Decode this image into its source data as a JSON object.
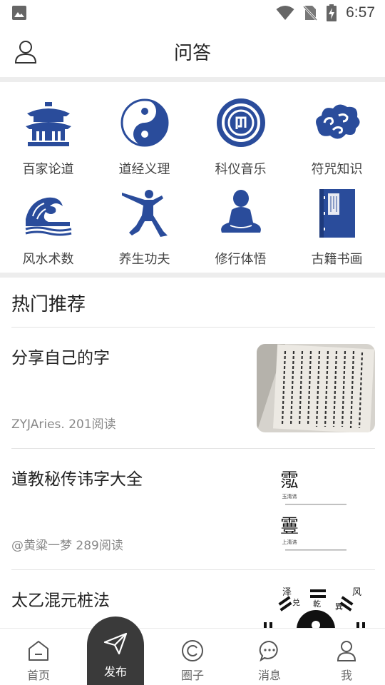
{
  "status_bar": {
    "time": "6:57"
  },
  "header": {
    "title": "问答"
  },
  "categories": [
    {
      "label": "百家论道",
      "icon": "temple-icon"
    },
    {
      "label": "道经义理",
      "icon": "yin-yang-icon"
    },
    {
      "label": "科仪音乐",
      "icon": "music-seal-icon"
    },
    {
      "label": "符咒知识",
      "icon": "cloud-icon"
    },
    {
      "label": "风水术数",
      "icon": "wave-icon"
    },
    {
      "label": "养生功夫",
      "icon": "kungfu-icon"
    },
    {
      "label": "修行体悟",
      "icon": "meditation-icon"
    },
    {
      "label": "古籍书画",
      "icon": "ancient-book-icon"
    }
  ],
  "recommend": {
    "title": "热门推荐",
    "posts": [
      {
        "title": "分享自己的字",
        "meta": "ZYJAries. 201阅读",
        "thumb": "calligraphy-photo"
      },
      {
        "title": "道教秘传讳字大全",
        "meta": "@黄粱一梦 289阅读",
        "thumb": "secret-characters",
        "thumb_text": {
          "glyph1": "霐",
          "caption1": "玉清讳",
          "glyph2": "霻",
          "caption2": "上清讳"
        }
      },
      {
        "title": "太乙混元桩法",
        "meta": "",
        "thumb": "bagua-diagram",
        "thumb_text": {
          "t1": "泽",
          "t2": "兑",
          "t3": "乾",
          "t4": "风",
          "t5": "巽"
        }
      }
    ]
  },
  "nav": {
    "home": "首页",
    "publish": "发布",
    "circle": "圈子",
    "messages": "消息",
    "me": "我"
  },
  "colors": {
    "accent_blue": "#2a4c9b",
    "nav_dark": "#3a3a3a"
  }
}
